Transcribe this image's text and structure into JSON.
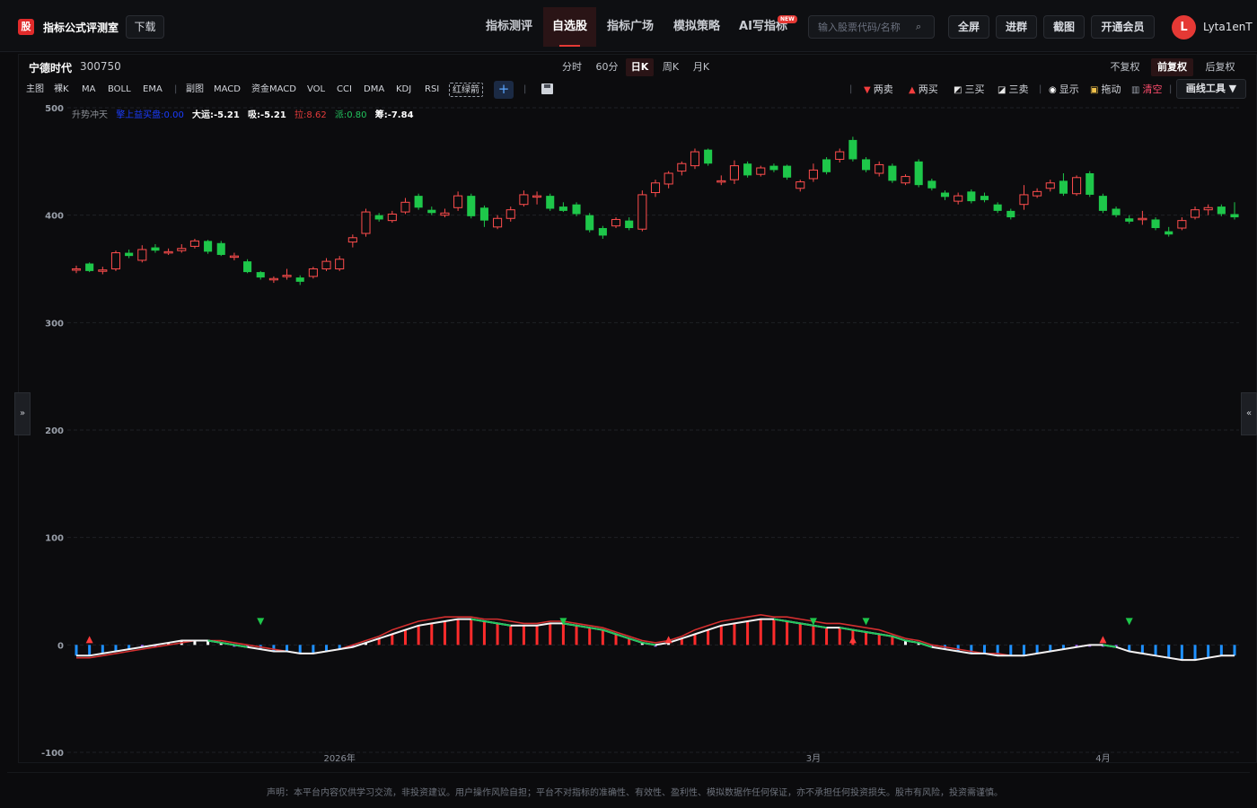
{
  "app": {
    "logo_glyph": "股",
    "brand": "指标公式评测室",
    "download_label": "下载"
  },
  "nav": [
    {
      "label": "指标测评",
      "active": false
    },
    {
      "label": "自选股",
      "active": true
    },
    {
      "label": "指标广场",
      "active": false
    },
    {
      "label": "模拟策略",
      "active": false
    },
    {
      "label": "AI写指标",
      "active": false
    }
  ],
  "new_badge": "NEW",
  "search": {
    "placeholder": "输入股票代码/名称",
    "icon": "search-icon"
  },
  "top_buttons": [
    "全屏",
    "进群",
    "截图",
    "开通会员"
  ],
  "user": {
    "initial": "L",
    "name": "Lyta1enT"
  },
  "stock": {
    "name": "宁德时代",
    "code": "300750"
  },
  "periods": [
    {
      "label": "分时",
      "active": false
    },
    {
      "label": "60分",
      "active": false
    },
    {
      "label": "日K",
      "active": true
    },
    {
      "label": "周K",
      "active": false
    },
    {
      "label": "月K",
      "active": false
    }
  ],
  "adjust": [
    {
      "label": "不复权",
      "active": false
    },
    {
      "label": "前复权",
      "active": true
    },
    {
      "label": "后复权",
      "active": false
    }
  ],
  "toolbar_left": [
    "主图",
    "裸K",
    "MA",
    "BOLL",
    "EMA",
    "|",
    "副图",
    "MACD",
    "资金MACD",
    "VOL",
    "CCI",
    "DMA",
    "KDJ",
    "RSI",
    "红绿箭"
  ],
  "toolbar_right": [
    {
      "glyph": "▼",
      "label": "两卖",
      "color": "#f23d3d",
      "icon": "triangle-down-icon"
    },
    {
      "glyph": "▲",
      "label": "两买",
      "color": "#f23d3d",
      "icon": "triangle-up-icon"
    },
    {
      "glyph": "◩",
      "label": "三买",
      "color": "#e8e8e8",
      "icon": "three-buy-icon"
    },
    {
      "glyph": "◪",
      "label": "三卖",
      "color": "#e8e8e8",
      "icon": "three-sell-icon"
    },
    {
      "glyph": "◉",
      "label": "显示",
      "color": "#ffffff",
      "icon": "eye-icon"
    },
    {
      "glyph": "🔒",
      "label": "拖动",
      "color": "#f0c14b",
      "icon": "lock-icon"
    },
    {
      "glyph": "🗑",
      "label": "清空",
      "color": "#9aa0aa",
      "icon": "trash-icon"
    }
  ],
  "clear_label_color": "#ff4d6d",
  "draw_tool": "画线工具 ▼",
  "side_left": "»",
  "side_right": "«",
  "indicator_legend": [
    {
      "text": "升势冲天",
      "color": "#8c8f96"
    },
    {
      "text": "擎上益买盘:0.00",
      "color": "#1a3cff"
    },
    {
      "text": "大运:-5.21",
      "color": "#ffffff"
    },
    {
      "text": "吸:-5.21",
      "color": "#ffffff"
    },
    {
      "text": "拉:8.62",
      "color": "#e33b3b"
    },
    {
      "text": "派:0.80",
      "color": "#22c55e"
    },
    {
      "text": "筹:-7.84",
      "color": "#ffffff"
    }
  ],
  "chart_data": {
    "type": "candlestick",
    "ylim": [
      -100,
      500
    ],
    "y_ticks": [
      "500",
      "400",
      "300",
      "200",
      "100",
      "0",
      "-100"
    ],
    "x_labels": [
      {
        "text": "2026年",
        "index": 20
      },
      {
        "text": "3月",
        "index": 56
      },
      {
        "text": "4月",
        "index": 78
      }
    ],
    "colors": {
      "up": "#ff4d4d",
      "down": "#1ec74a"
    },
    "candles": [
      [
        349,
        350,
        346,
        353
      ],
      [
        355,
        348,
        347,
        356
      ],
      [
        348,
        349,
        345,
        352
      ],
      [
        350,
        365,
        348,
        367
      ],
      [
        365,
        362,
        360,
        368
      ],
      [
        358,
        368,
        356,
        372
      ],
      [
        370,
        367,
        365,
        373
      ],
      [
        366,
        366,
        363,
        369
      ],
      [
        367,
        369,
        365,
        373
      ],
      [
        371,
        376,
        369,
        378
      ],
      [
        376,
        366,
        364,
        377
      ],
      [
        374,
        363,
        362,
        376
      ],
      [
        362,
        362,
        358,
        365
      ],
      [
        357,
        347,
        346,
        359
      ],
      [
        347,
        342,
        340,
        348
      ],
      [
        341,
        341,
        337,
        343
      ],
      [
        344,
        344,
        340,
        350
      ],
      [
        342,
        338,
        335,
        344
      ],
      [
        343,
        350,
        341,
        352
      ],
      [
        350,
        357,
        348,
        360
      ],
      [
        350,
        359,
        348,
        362
      ],
      [
        375,
        379,
        370,
        382
      ],
      [
        383,
        403,
        380,
        406
      ],
      [
        400,
        396,
        394,
        402
      ],
      [
        395,
        401,
        393,
        404
      ],
      [
        403,
        412,
        401,
        416
      ],
      [
        418,
        407,
        405,
        420
      ],
      [
        405,
        402,
        400,
        408
      ],
      [
        400,
        402,
        398,
        406
      ],
      [
        407,
        418,
        404,
        422
      ],
      [
        418,
        399,
        397,
        420
      ],
      [
        407,
        395,
        389,
        409
      ],
      [
        389,
        397,
        387,
        400
      ],
      [
        397,
        405,
        394,
        408
      ],
      [
        410,
        419,
        408,
        423
      ],
      [
        418,
        418,
        410,
        422
      ],
      [
        418,
        406,
        404,
        420
      ],
      [
        408,
        404,
        403,
        412
      ],
      [
        410,
        401,
        399,
        412
      ],
      [
        400,
        386,
        384,
        402
      ],
      [
        388,
        381,
        378,
        390
      ],
      [
        390,
        396,
        388,
        398
      ],
      [
        395,
        388,
        386,
        398
      ],
      [
        387,
        419,
        385,
        423
      ],
      [
        421,
        430,
        417,
        433
      ],
      [
        429,
        439,
        425,
        441
      ],
      [
        441,
        448,
        437,
        450
      ],
      [
        446,
        459,
        443,
        462
      ],
      [
        461,
        448,
        446,
        462
      ],
      [
        432,
        432,
        428,
        437
      ],
      [
        433,
        446,
        429,
        451
      ],
      [
        448,
        437,
        435,
        450
      ],
      [
        438,
        444,
        436,
        446
      ],
      [
        446,
        442,
        440,
        448
      ],
      [
        446,
        435,
        433,
        447
      ],
      [
        425,
        431,
        422,
        433
      ],
      [
        434,
        442,
        431,
        448
      ],
      [
        452,
        440,
        438,
        454
      ],
      [
        452,
        459,
        449,
        462
      ],
      [
        470,
        452,
        450,
        473
      ],
      [
        452,
        442,
        440,
        454
      ],
      [
        439,
        447,
        436,
        450
      ],
      [
        446,
        432,
        430,
        448
      ],
      [
        430,
        436,
        428,
        438
      ],
      [
        450,
        428,
        426,
        452
      ],
      [
        432,
        425,
        423,
        434
      ],
      [
        421,
        417,
        414,
        423
      ],
      [
        413,
        418,
        410,
        421
      ],
      [
        422,
        413,
        411,
        424
      ],
      [
        418,
        414,
        412,
        421
      ],
      [
        410,
        404,
        402,
        412
      ],
      [
        404,
        398,
        396,
        406
      ],
      [
        410,
        419,
        405,
        428
      ],
      [
        418,
        422,
        416,
        425
      ],
      [
        425,
        430,
        422,
        433
      ],
      [
        432,
        420,
        418,
        439
      ],
      [
        420,
        435,
        418,
        437
      ],
      [
        439,
        419,
        417,
        441
      ],
      [
        418,
        404,
        402,
        420
      ],
      [
        406,
        400,
        398,
        408
      ],
      [
        397,
        394,
        392,
        400
      ],
      [
        397,
        397,
        391,
        404
      ],
      [
        396,
        388,
        386,
        398
      ],
      [
        385,
        382,
        380,
        389
      ],
      [
        388,
        395,
        386,
        398
      ],
      [
        398,
        405,
        396,
        408
      ],
      [
        405,
        407,
        400,
        410
      ],
      [
        408,
        401,
        399,
        410
      ],
      [
        401,
        398,
        396,
        412
      ]
    ],
    "indicator_lines": {
      "white_line": [
        -5,
        -5,
        -4,
        -3,
        -2,
        -1,
        0,
        1,
        2,
        2,
        2,
        1,
        0,
        -1,
        -2,
        -3,
        -3,
        -4,
        -4,
        -3,
        -2,
        -1,
        1,
        3,
        5,
        7,
        9,
        10,
        11,
        12,
        12,
        11,
        10,
        9,
        9,
        9,
        10,
        10,
        9,
        8,
        7,
        5,
        3,
        1,
        0,
        1,
        3,
        5,
        7,
        9,
        10,
        11,
        12,
        12,
        11,
        10,
        9,
        8,
        8,
        7,
        6,
        5,
        4,
        2,
        1,
        -1,
        -2,
        -3,
        -4,
        -4,
        -5,
        -5,
        -5,
        -4,
        -3,
        -2,
        -1,
        0,
        0,
        -1,
        -3,
        -4,
        -5,
        -6,
        -7,
        -7,
        -6,
        -5,
        -5
      ],
      "red_line": [
        -6,
        -6,
        -5,
        -4,
        -3,
        -2,
        -1,
        0,
        1,
        2,
        2,
        2,
        1,
        0,
        -1,
        -2,
        -3,
        -4,
        -4,
        -3,
        -2,
        0,
        2,
        4,
        7,
        9,
        11,
        12,
        13,
        13,
        13,
        12,
        12,
        11,
        10,
        10,
        11,
        11,
        10,
        9,
        8,
        6,
        4,
        2,
        1,
        2,
        4,
        7,
        9,
        11,
        12,
        13,
        14,
        13,
        13,
        12,
        11,
        10,
        10,
        9,
        8,
        7,
        5,
        3,
        2,
        0,
        -1,
        -2,
        -3,
        -4,
        -4,
        -5,
        -5,
        -4,
        -3,
        -2,
        -1,
        0,
        0,
        -1,
        -3,
        -4,
        -5,
        -6,
        -7,
        -7,
        -6,
        -5,
        -5
      ]
    },
    "markers": [
      {
        "index": 1,
        "kind": "up"
      },
      {
        "index": 14,
        "kind": "down"
      },
      {
        "index": 37,
        "kind": "down"
      },
      {
        "index": 45,
        "kind": "up"
      },
      {
        "index": 56,
        "kind": "down"
      },
      {
        "index": 59,
        "kind": "up"
      },
      {
        "index": 60,
        "kind": "down"
      },
      {
        "index": 78,
        "kind": "up"
      },
      {
        "index": 80,
        "kind": "down"
      }
    ]
  },
  "disclaimer": "声明：本平台内容仅供学习交流，非投资建议。用户操作风险自担；平台不对指标的准确性、有效性、盈利性、模拟数据作任何保证，亦不承担任何投资损失。股市有风险，投资需谨慎。"
}
